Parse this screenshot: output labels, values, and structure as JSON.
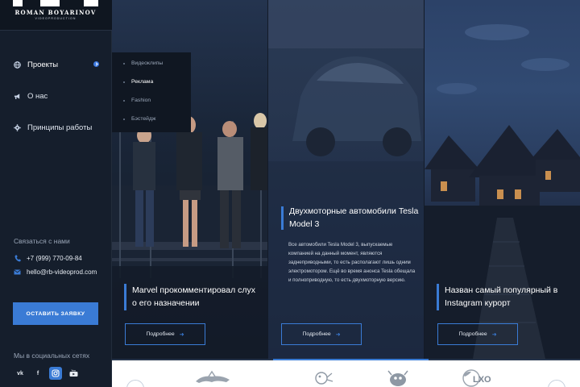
{
  "brand": {
    "name": "ROMAN BOYARINOV",
    "subtitle": "VIDEOPRODUCTION"
  },
  "nav": {
    "items": [
      {
        "label": "Проекты",
        "icon": "globe-icon",
        "active": true
      },
      {
        "label": "О нас",
        "icon": "megaphone-icon",
        "active": false
      },
      {
        "label": "Принципы работы",
        "icon": "gear-icon",
        "active": false
      }
    ]
  },
  "submenu": {
    "items": [
      {
        "label": "Видеоклипы",
        "active": false
      },
      {
        "label": "Реклама",
        "active": true
      },
      {
        "label": "Fashion",
        "active": false
      },
      {
        "label": "Бэстейдж",
        "active": false
      }
    ]
  },
  "contacts": {
    "title": "Связаться с нами",
    "phone": "+7 (999) 770-09-84",
    "email": "hello@rb-videoprod.com"
  },
  "cta": {
    "label": "ОСТАВИТЬ ЗАЯВКУ"
  },
  "social": {
    "title": "Мы в социальных сетях",
    "items": [
      {
        "label": "vk",
        "icon": "vk-icon",
        "active": false
      },
      {
        "label": "f",
        "icon": "facebook-icon",
        "active": false
      },
      {
        "label": "",
        "icon": "instagram-icon",
        "active": true
      },
      {
        "label": "",
        "icon": "youtube-icon",
        "active": false
      }
    ]
  },
  "slides": [
    {
      "title": "Marvel прокомментировал слух о его назначении",
      "button": "Подробнее",
      "image": "group-of-people-photo"
    },
    {
      "title": "Двухмоторные автомобили Tesla Model 3",
      "description": "Все автомобили Tesla Model 3, выпускаемые компанией на данный момент, являются заднеприводными, то есть располагают лишь одним электромотором. Ещё во время анонса Tesla обещала и полноприводную, то есть двухмоторную версию.",
      "button": "Подробнее",
      "image": "car-photo"
    },
    {
      "title": "Назван самый популярный в Instagram курорт",
      "button": "Подробнее",
      "image": "resort-huts-photo"
    }
  ],
  "partners": {
    "logos": [
      "lacoste-logo",
      "fish-character-logo",
      "mascot-logo",
      "lxo-logo"
    ],
    "lxo_text": "LXO"
  },
  "colors": {
    "accent": "#3a7bd5",
    "sidebar": "#151e2c",
    "submenu": "#101722"
  }
}
